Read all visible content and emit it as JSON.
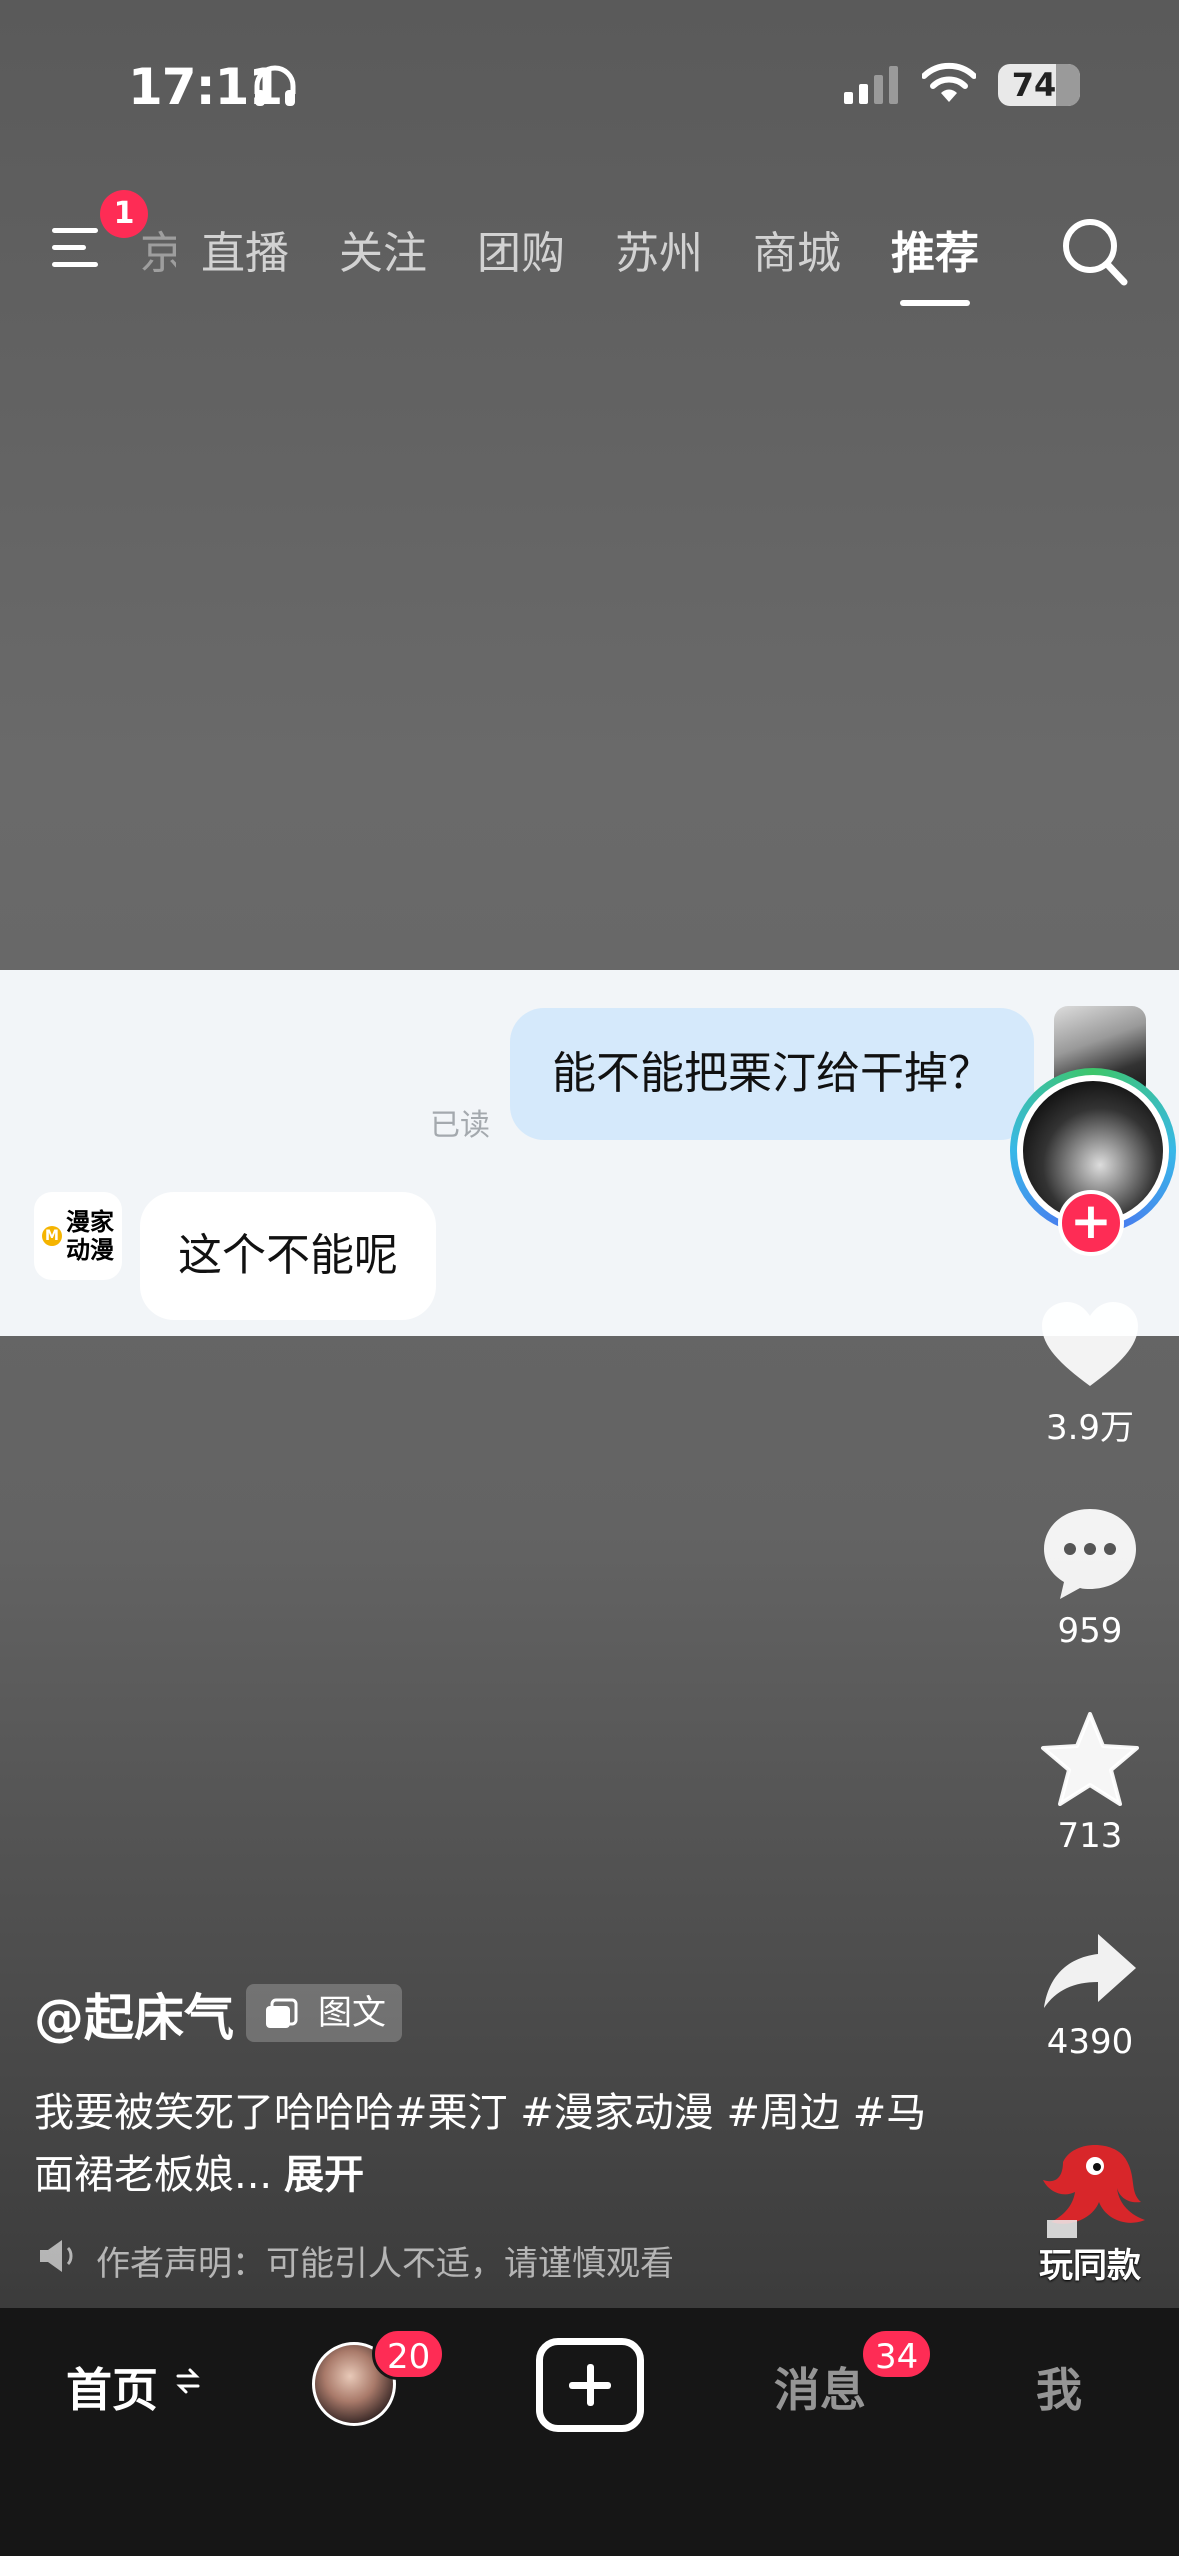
{
  "status_bar": {
    "time": "17:11",
    "battery": "74"
  },
  "top_nav": {
    "menu_badge": "1",
    "tabs": [
      {
        "label": "京",
        "state": "partial"
      },
      {
        "label": "直播"
      },
      {
        "label": "关注"
      },
      {
        "label": "团购"
      },
      {
        "label": "苏州"
      },
      {
        "label": "商城"
      },
      {
        "label": "推荐",
        "active": true
      }
    ]
  },
  "chat": {
    "outgoing": "能不能把栗汀给干掉？",
    "read_status": "已读",
    "incoming_app_name": "漫家动漫",
    "incoming": "这个不能呢"
  },
  "actions": {
    "likes": "3.9万",
    "comments": "959",
    "favorites": "713",
    "shares": "4390",
    "remix_label": "玩同款"
  },
  "post": {
    "author": "@起床气",
    "type_tag": "图文",
    "description": "我要被笑死了哈哈哈#栗汀 #漫家动漫 #周边 #马面裙老板娘...",
    "expand": "展开",
    "notice": "作者声明：可能引人不适，请谨慎观看"
  },
  "bottom_bar": {
    "home": "首页",
    "friends_badge": "20",
    "messages": "消息",
    "messages_badge": "34",
    "me": "我"
  },
  "colors": {
    "accent_red": "#fe2c55",
    "bubble_out": "#d5e9fb"
  }
}
